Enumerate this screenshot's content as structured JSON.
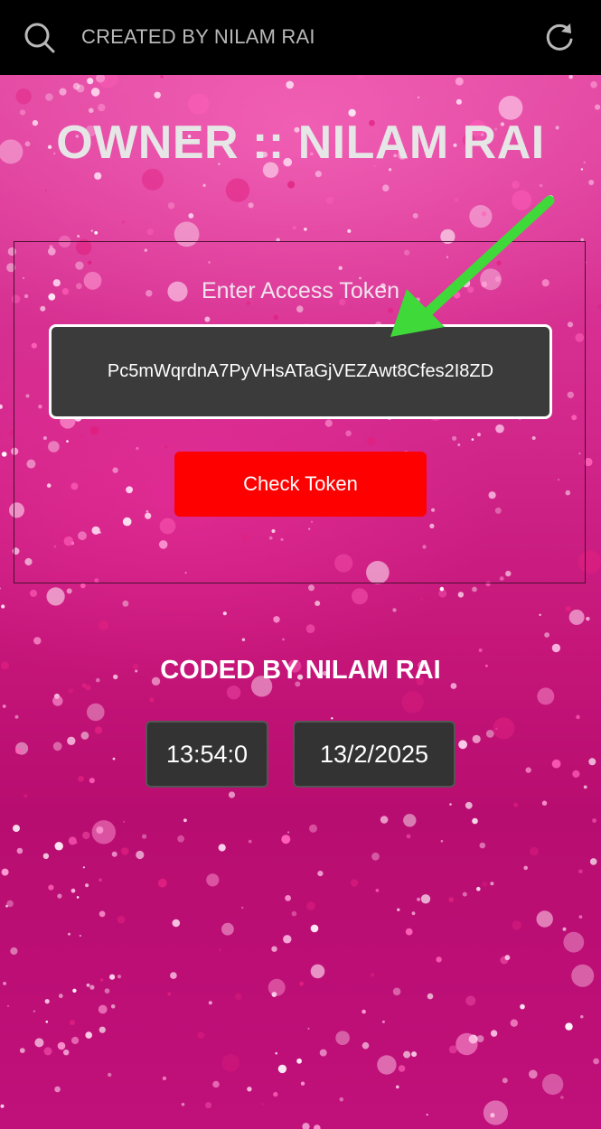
{
  "topbar": {
    "title": "CREATED BY NILAM RAI",
    "left_icon": "search-icon",
    "right_icon": "refresh-icon"
  },
  "owner_heading": "OWNER :: NILAM RAI",
  "token_form": {
    "label": "Enter Access Token",
    "token_value": "Pc5mWqrdnA7PyVHsATaGjVEZAwt8Cfes2I8ZD",
    "check_button_label": "Check Token"
  },
  "footer": {
    "coded_by": "CODED BY NILAM RAI",
    "time": "13:54:0",
    "date": "13/2/2025"
  },
  "colors": {
    "background": "#c8107a",
    "topbar": "#000000",
    "button": "#fe0000",
    "input_bg": "#3b3b3b",
    "arrow": "#3fd93a"
  }
}
